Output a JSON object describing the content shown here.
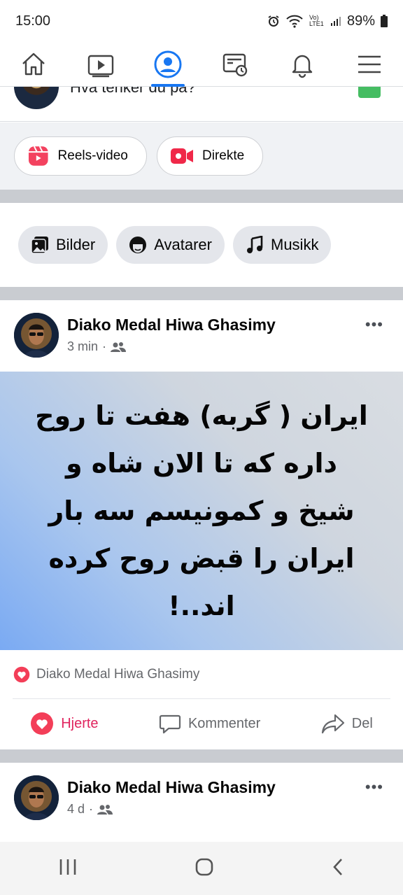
{
  "status_bar": {
    "time": "15:00",
    "network_label": "Vo) LTE1",
    "battery": "89%"
  },
  "nav": {
    "items": [
      {
        "name": "home-icon"
      },
      {
        "name": "video-icon"
      },
      {
        "name": "profile-icon",
        "active": true
      },
      {
        "name": "news-icon"
      },
      {
        "name": "bell-icon"
      },
      {
        "name": "menu-icon"
      }
    ]
  },
  "composer": {
    "prompt": "Hva tenker du på?"
  },
  "create": {
    "reels_label": "Reels-video",
    "live_label": "Direkte"
  },
  "chips": [
    {
      "label": "Bilder"
    },
    {
      "label": "Avatarer"
    },
    {
      "label": "Musikk"
    }
  ],
  "post1": {
    "author": "Diako Medal Hiwa Ghasimy",
    "time": "3 min",
    "body": "ایران ( گربه) هفت تا روح داره که تا الان شاه و شیخ و کمونیسم سه بار ایران را قبض روح کرده اند..!",
    "reacted_by": "Diako Medal Hiwa Ghasimy",
    "actions": {
      "like": "Hjerte",
      "comment": "Kommenter",
      "share": "Del"
    }
  },
  "post2": {
    "author": "Diako Medal Hiwa Ghasimy",
    "time": "4 d"
  },
  "colors": {
    "accent": "#1877f2",
    "heart": "#f33e58",
    "reels": "#f3425f",
    "live": "#f02849"
  }
}
